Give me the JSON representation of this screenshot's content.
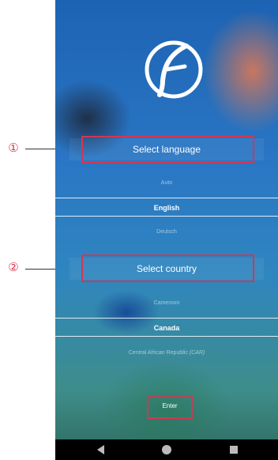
{
  "callouts": {
    "one": "①",
    "two": "②"
  },
  "language": {
    "button_label": "Select language",
    "options": [
      "Auto",
      "English",
      "Deutsch"
    ],
    "selected": "English"
  },
  "country": {
    "button_label": "Select country",
    "options": [
      "Cameroon",
      "Canada",
      "Central African Republic"
    ],
    "car_suffix": "(CAR)",
    "selected": "Canada"
  },
  "enter_label": "Enter",
  "colors": {
    "highlight": "#d8354f",
    "navbar": "#000000"
  },
  "icons": {
    "logo": "fluval-f-logo",
    "back": "back-triangle-icon",
    "home": "home-circle-icon",
    "recents": "recents-square-icon"
  }
}
